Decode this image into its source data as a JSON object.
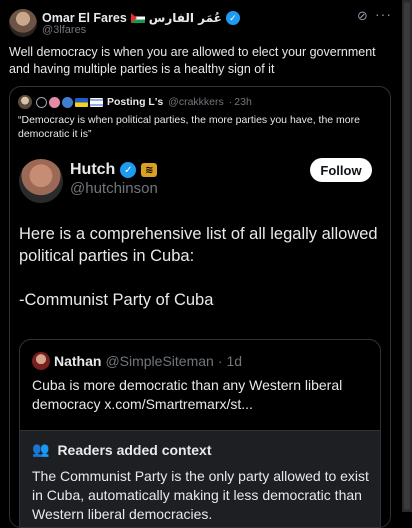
{
  "outer_tweet": {
    "name": "Omar El Fares",
    "name_arabic": "عُمَر الفارس",
    "handle": "@3lfares",
    "text": "Well democracy is when you are allowed to elect your government and having multiple parties is a healthy sign of it",
    "icons": [
      "palestine-flag-icon",
      "verified-icon",
      "grok-icon",
      "more-icon"
    ]
  },
  "quoted_tweet": {
    "name": "Posting L's",
    "handle": "@crakkkers",
    "time": "23h",
    "text": "“Democracy is when political parties, the more parties you have, the more democratic it is”"
  },
  "embedded_post": {
    "name": "Hutch",
    "handle": "@hutchinson",
    "follow_label": "Follow",
    "line1": "Here is a comprehensive list of all legally allowed political parties in Cuba:",
    "line2": "-Communist Party of Cuba"
  },
  "inner_quote": {
    "name": "Nathan",
    "handle": "@SimpleSiteman",
    "time": "1d",
    "text": "Cuba is more democratic than any Western liberal democracy x.com/Smartremarx/st...",
    "context_title": "Readers added context",
    "context_text": "The Communist Party is the only party allowed to exist in Cuba, automatically making it less democratic than Western liberal democracies."
  },
  "colors": {
    "background": "#000000",
    "text": "#e7e9ea",
    "muted": "#71767b",
    "verified": "#1d9bf0",
    "border": "#2f3336"
  }
}
